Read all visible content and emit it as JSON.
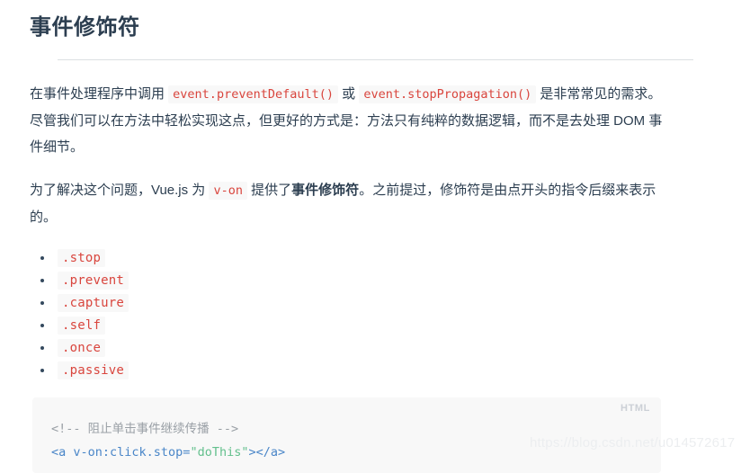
{
  "title": "事件修饰符",
  "paragraphs": {
    "p1": {
      "t1": "在事件处理程序中调用 ",
      "code1": "event.preventDefault()",
      "t2": " 或 ",
      "code2": "event.stopPropagation()",
      "t3": " 是非常常见的需求。尽管我们可以在方法中轻松实现这点，但更好的方式是：方法只有纯粹的数据逻辑，而不是去处理 DOM 事件细节。"
    },
    "p2": {
      "t1": "为了解决这个问题，Vue.js 为 ",
      "code1": "v-on",
      "t2": " 提供了",
      "bold1": "事件修饰符",
      "t3": "。之前提过，修饰符是由点开头的指令后缀来表示的。"
    }
  },
  "modifiers": [
    ".stop",
    ".prevent",
    ".capture",
    ".self",
    ".once",
    ".passive"
  ],
  "code_block": {
    "language_label": "HTML",
    "line1_comment": "<!-- 阻止单击事件继续传播 -->",
    "line2": {
      "tag_open": "<a v-on:click.stop=",
      "string": "\"doThis\"",
      "tag_close": "></a>"
    }
  },
  "watermark": "https://blog.csdn.net/u014572617",
  "colors": {
    "text": "#2c3e50",
    "inline_code": "#d9453d",
    "inline_code_bg": "#f8f8f8",
    "code_block_bg": "#f8f8f8",
    "code_tag": "#4a86c8",
    "code_string": "#63c08d",
    "code_comment": "#9aa0a6",
    "rule": "#dcdfe2"
  }
}
